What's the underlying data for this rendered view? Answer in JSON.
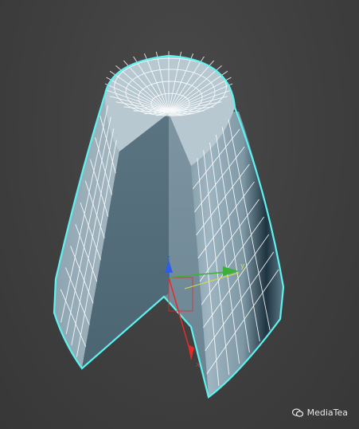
{
  "viewport": {
    "object": "sliced-cone",
    "wireframe_color": "#ffffff",
    "selection_outline_color": "#5ef3f0",
    "face_color": "#8aa3b0",
    "axes": {
      "x_label": "x",
      "y_label": "y",
      "z_label": "z",
      "x_color": "#e32b2b",
      "y_color": "#3ab23a",
      "z_color": "#2a5df0"
    }
  },
  "watermark": {
    "text": "MediaTea",
    "icon": "wechat-icon"
  }
}
